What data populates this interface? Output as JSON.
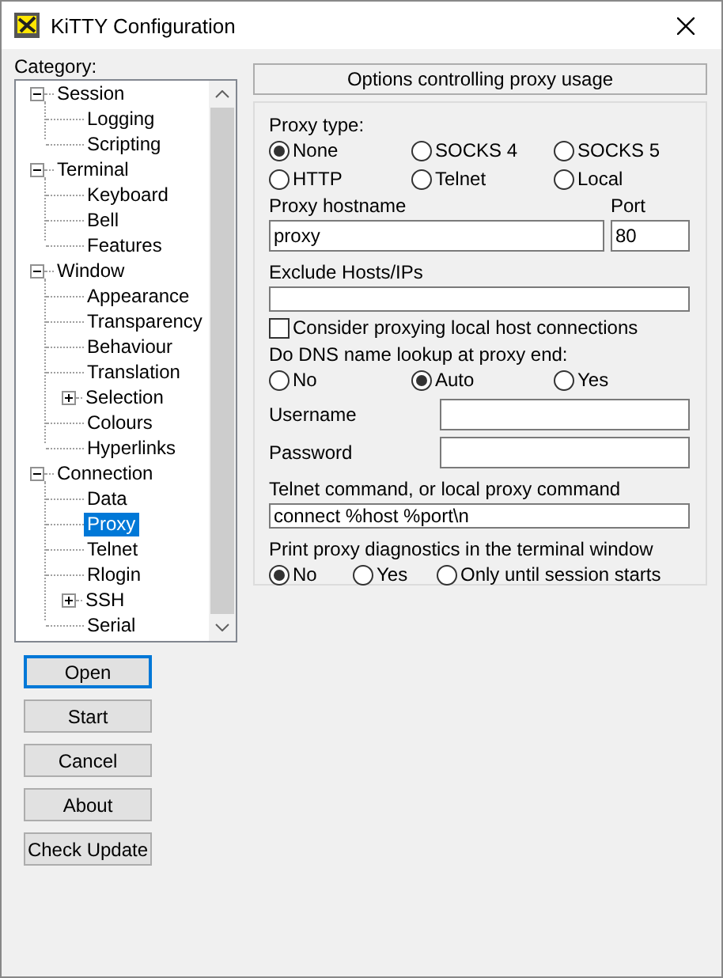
{
  "window": {
    "title": "KiTTY Configuration"
  },
  "category_label": "Category:",
  "tree": [
    {
      "label": "Session",
      "expanded": true,
      "selected": false,
      "children": [
        {
          "label": "Logging",
          "selected": false
        },
        {
          "label": "Scripting",
          "selected": false
        }
      ]
    },
    {
      "label": "Terminal",
      "expanded": true,
      "selected": false,
      "children": [
        {
          "label": "Keyboard",
          "selected": false
        },
        {
          "label": "Bell",
          "selected": false
        },
        {
          "label": "Features",
          "selected": false
        }
      ]
    },
    {
      "label": "Window",
      "expanded": true,
      "selected": false,
      "children": [
        {
          "label": "Appearance",
          "selected": false
        },
        {
          "label": "Transparency",
          "selected": false
        },
        {
          "label": "Behaviour",
          "selected": false
        },
        {
          "label": "Translation",
          "selected": false
        },
        {
          "label": "Selection",
          "expanded": false,
          "selected": false
        },
        {
          "label": "Colours",
          "selected": false
        },
        {
          "label": "Hyperlinks",
          "selected": false
        }
      ]
    },
    {
      "label": "Connection",
      "expanded": true,
      "selected": false,
      "children": [
        {
          "label": "Data",
          "selected": false
        },
        {
          "label": "Proxy",
          "selected": true
        },
        {
          "label": "Telnet",
          "selected": false
        },
        {
          "label": "Rlogin",
          "selected": false
        },
        {
          "label": "SSH",
          "expanded": false,
          "selected": false
        },
        {
          "label": "Serial",
          "selected": false
        }
      ]
    }
  ],
  "buttons": [
    {
      "label": "Open",
      "default": true
    },
    {
      "label": "Start",
      "default": false
    },
    {
      "label": "Cancel",
      "default": false
    },
    {
      "label": "About",
      "default": false
    },
    {
      "label": "Check Update",
      "default": false
    }
  ],
  "panel": {
    "header": "Options controlling proxy usage",
    "proxy_type": {
      "label": "Proxy type:",
      "options": [
        {
          "label": "None",
          "selected": true
        },
        {
          "label": "SOCKS 4",
          "selected": false
        },
        {
          "label": "SOCKS 5",
          "selected": false
        },
        {
          "label": "HTTP",
          "selected": false
        },
        {
          "label": "Telnet",
          "selected": false
        },
        {
          "label": "Local",
          "selected": false
        }
      ]
    },
    "hostname": {
      "label": "Proxy hostname",
      "value": "proxy"
    },
    "port": {
      "label": "Port",
      "value": "80"
    },
    "exclude": {
      "label": "Exclude Hosts/IPs"
    },
    "local_hosts": {
      "label": "Consider proxying local host connections",
      "checked": false
    },
    "dns": {
      "label": "Do DNS name lookup at proxy end:",
      "options": [
        {
          "label": "No",
          "selected": false
        },
        {
          "label": "Auto",
          "selected": true
        },
        {
          "label": "Yes",
          "selected": false
        }
      ]
    },
    "username": {
      "label": "Username"
    },
    "password": {
      "label": "Password"
    },
    "command": {
      "label": "Telnet command, or local proxy command",
      "value": "connect %host %port\\n"
    },
    "diagnostics": {
      "label": "Print proxy diagnostics in the terminal window",
      "options": [
        {
          "label": "No",
          "selected": true
        },
        {
          "label": "Yes",
          "selected": false
        },
        {
          "label": "Only until session starts",
          "selected": false
        }
      ]
    }
  }
}
